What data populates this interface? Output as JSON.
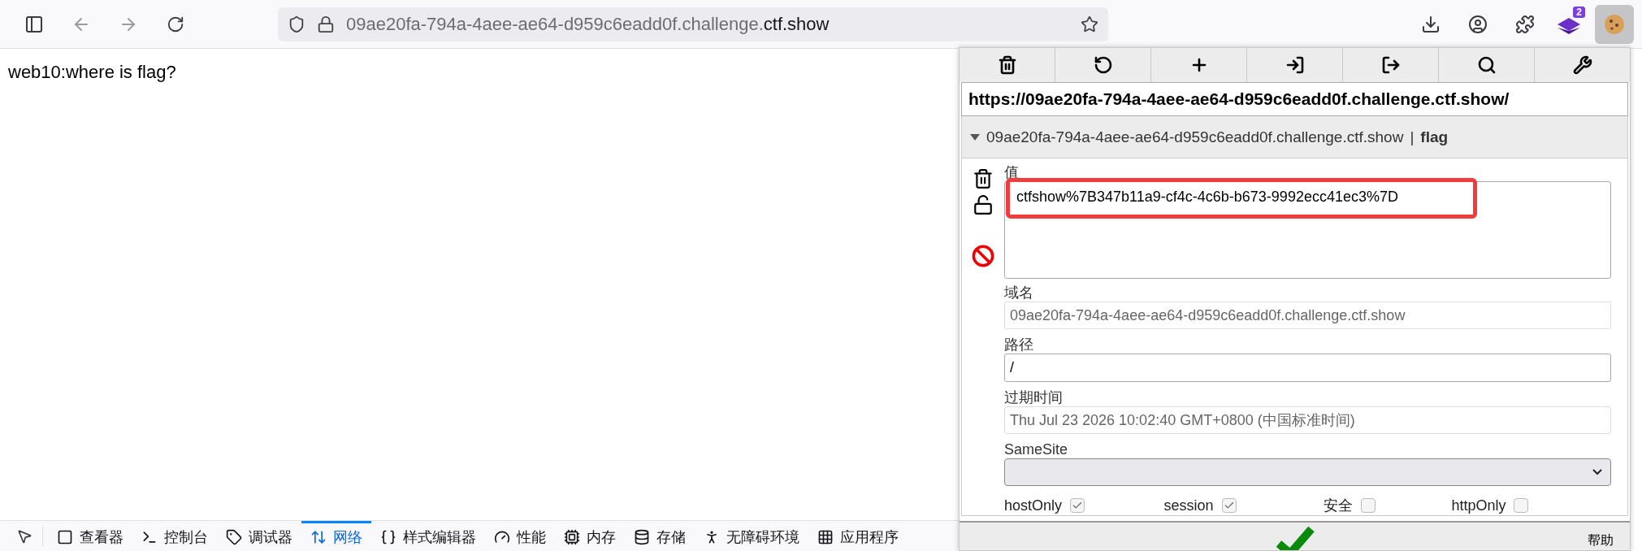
{
  "browser": {
    "url_host": "09ae20fa-794a-4aee-ae64-d959c6eadd0f.challenge.",
    "url_domain": "ctf.show",
    "extension_badge": "2"
  },
  "page": {
    "text": "web10:where is flag?"
  },
  "cookie_editor": {
    "toolbar": [
      {
        "kind": "delete"
      },
      {
        "kind": "reset"
      },
      {
        "kind": "add"
      },
      {
        "kind": "import"
      },
      {
        "kind": "export"
      },
      {
        "kind": "search"
      },
      {
        "kind": "settings"
      }
    ],
    "url": "https://09ae20fa-794a-4aee-ae64-d959c6eadd0f.challenge.ctf.show/",
    "cookie": {
      "expanded": true,
      "domain": "09ae20fa-794a-4aee-ae64-d959c6eadd0f.challenge.ctf.show",
      "separator": "|",
      "name": "flag"
    },
    "value_label": "值",
    "value": "ctfshow%7B347b11a9-cf4c-4c6b-b673-9992ecc41ec3%7D",
    "highlighted": true,
    "locked": false,
    "fields": [
      {
        "label": "域名",
        "value": "09ae20fa-794a-4aee-ae64-d959c6eadd0f.challenge.ctf.show",
        "disabled": true
      },
      {
        "label": "路径",
        "value": "/",
        "disabled": false
      },
      {
        "label": "过期时间",
        "value": "Thu Jul 23 2026 10:02:40 GMT+0800 (中国标准时间)",
        "disabled": true
      }
    ],
    "samesite_label": "SameSite",
    "flags": [
      {
        "label": "hostOnly",
        "checked": true
      },
      {
        "label": "session",
        "checked": true
      },
      {
        "label": "安全",
        "checked": false
      },
      {
        "label": "httpOnly",
        "checked": false
      }
    ],
    "help": "帮助"
  },
  "devtools": {
    "tabs": [
      {
        "kind": "inspector",
        "label": "查看器",
        "selected": false
      },
      {
        "kind": "console",
        "label": "控制台",
        "selected": false
      },
      {
        "kind": "debugger",
        "label": "调试器",
        "selected": false
      },
      {
        "kind": "network",
        "label": "网络",
        "selected": true
      },
      {
        "kind": "style",
        "label": "样式编辑器",
        "selected": false
      },
      {
        "kind": "performance",
        "label": "性能",
        "selected": false
      },
      {
        "kind": "memory",
        "label": "内存",
        "selected": false
      },
      {
        "kind": "storage",
        "label": "存储",
        "selected": false
      },
      {
        "kind": "accessibility",
        "label": "无障碍环境",
        "selected": false
      },
      {
        "kind": "application",
        "label": "应用程序",
        "selected": false
      }
    ]
  }
}
